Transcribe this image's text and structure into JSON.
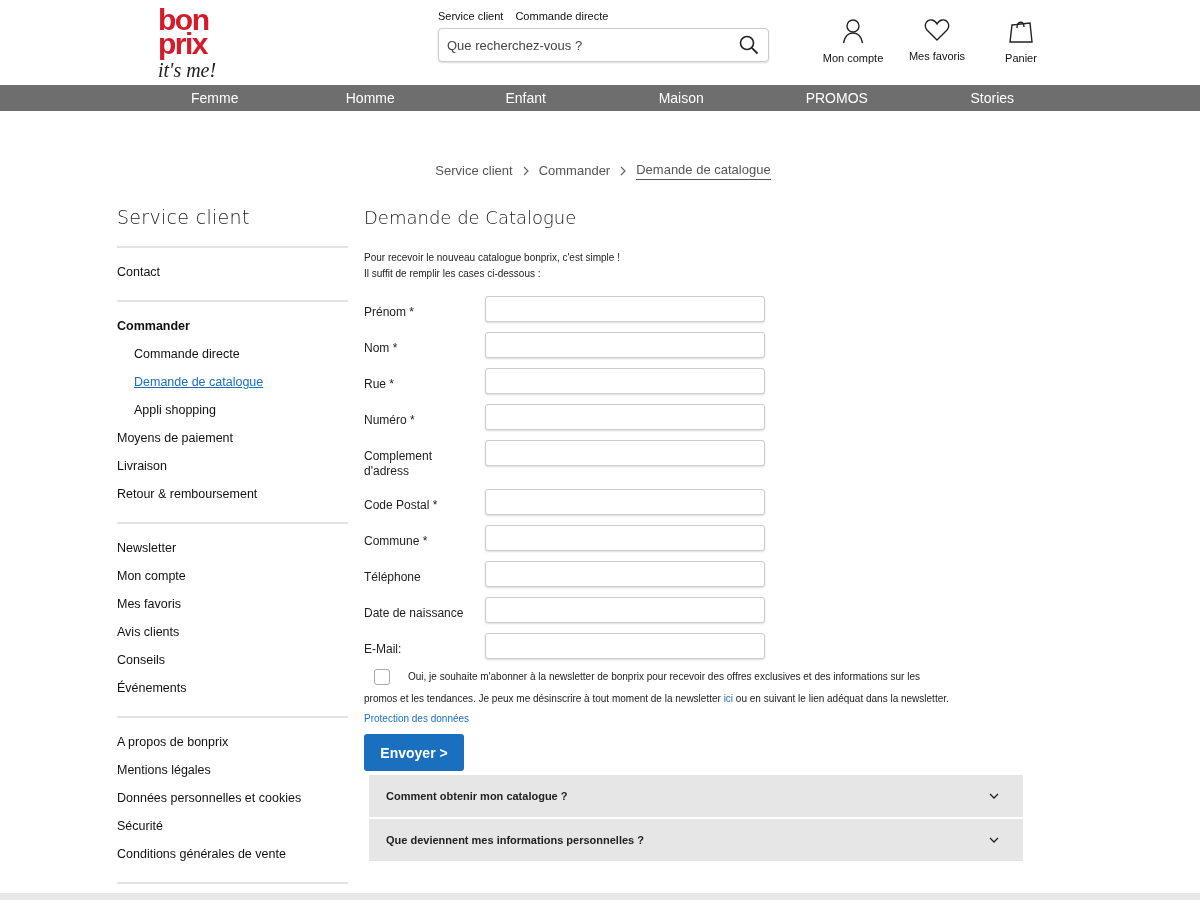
{
  "header": {
    "logo": {
      "line_1": "bon",
      "line_2": "prix",
      "tagline": "it's me!"
    },
    "top_links": [
      "Service client",
      "Commande directe"
    ],
    "search": {
      "placeholder": "Que recherchez-vous ?"
    },
    "actions": [
      {
        "kind": "account",
        "label": "Mon compte"
      },
      {
        "kind": "favorites",
        "label": "Mes favoris"
      },
      {
        "kind": "cart",
        "label": "Panier"
      }
    ]
  },
  "nav": [
    "Femme",
    "Homme",
    "Enfant",
    "Maison",
    "PROMOS",
    "Stories"
  ],
  "breadcrumb": [
    {
      "label": "Service client",
      "selected": false
    },
    {
      "label": "Commander",
      "selected": false
    },
    {
      "label": "Demande de catalogue",
      "selected": true
    }
  ],
  "sidebar": {
    "title": "Service client",
    "groups": [
      [
        {
          "label": "Contact",
          "kind": "link",
          "selected": false
        }
      ],
      [
        {
          "label": "Commander",
          "kind": "heading",
          "selected": false,
          "children": [
            {
              "label": "Commande directe",
              "selected": false
            },
            {
              "label": "Demande de catalogue",
              "selected": true
            },
            {
              "label": "Appli shopping",
              "selected": false
            }
          ]
        },
        {
          "label": "Moyens de paiement",
          "kind": "link",
          "selected": false
        },
        {
          "label": "Livraison",
          "kind": "link",
          "selected": false
        },
        {
          "label": "Retour & remboursement",
          "kind": "link",
          "selected": false
        }
      ],
      [
        {
          "label": "Newsletter",
          "kind": "link",
          "selected": false
        },
        {
          "label": "Mon compte",
          "kind": "link",
          "selected": false
        },
        {
          "label": "Mes favoris",
          "kind": "link",
          "selected": false
        },
        {
          "label": "Avis clients",
          "kind": "link",
          "selected": false
        },
        {
          "label": "Conseils",
          "kind": "link",
          "selected": false
        },
        {
          "label": "Événements",
          "kind": "link",
          "selected": false
        }
      ],
      [
        {
          "label": "A propos de bonprix",
          "kind": "link",
          "selected": false
        },
        {
          "label": "Mentions légales",
          "kind": "link",
          "selected": false
        },
        {
          "label": "Données personnelles et cookies",
          "kind": "link",
          "selected": false
        },
        {
          "label": "Sécurité",
          "kind": "link",
          "selected": false
        },
        {
          "label": "Conditions générales de vente",
          "kind": "link",
          "selected": false
        }
      ]
    ]
  },
  "main": {
    "title": "Demande de Catalogue",
    "intro": [
      "Pour recevoir le nouveau catalogue bonprix, c'est simple !",
      "Il suffit de remplir les cases ci-dessous :"
    ],
    "fields": [
      {
        "label": "Prénom *"
      },
      {
        "label": "Nom *"
      },
      {
        "label": "Rue *"
      },
      {
        "label": "Numéro *"
      },
      {
        "label": "Complement d'adress"
      },
      {
        "label": "Code Postal *"
      },
      {
        "label": "Commune *"
      },
      {
        "label": "Téléphone"
      },
      {
        "label": "Date de naissance"
      },
      {
        "label": "E-Mail:"
      }
    ],
    "newsletter": {
      "checked": false,
      "line_1": "Oui, je souhaite m'abonner à la newsletter de bonprix pour recevoir des offres exclusives et des informations sur les",
      "text_before": "promos et les tendances. Je peux me désinscrire à tout moment de la newsletter",
      "link": "ici",
      "text_after": "ou en suivant le lien adéquat dans la newsletter."
    },
    "privacy_link": "Protection des données",
    "submit": "Envoyer >",
    "faq": [
      {
        "question": "Comment obtenir mon catalogue ?",
        "expanded": false
      },
      {
        "question": "Que deviennent mes informations personnelles ?",
        "expanded": false
      }
    ]
  }
}
